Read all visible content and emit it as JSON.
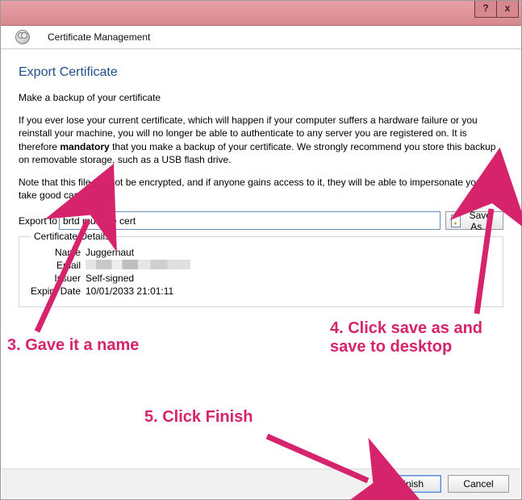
{
  "titlebar": {
    "help_symbol": "?",
    "close_symbol": "x"
  },
  "subheader": {
    "title": "Certificate Management"
  },
  "page": {
    "title": "Export Certificate",
    "intro": "Make a backup of your certificate",
    "para1_a": "If you ever lose your current certificate, which will happen if your computer suffers a hardware failure or you reinstall your machine, you will no longer be able to authenticate to any server you are registered on. It is therefore ",
    "para1_strong": "mandatory",
    "para1_b": " that you make a backup of your certificate. We strongly recommend you store this backup on removable storage, such as a USB flash drive.",
    "para2": "Note that this file will not be encrypted, and if anyone gains access to it, they will be able to impersonate you, so take good care of it."
  },
  "export": {
    "label": "Export to",
    "value": "brtd mumble cert",
    "save_label": "Save As..."
  },
  "details": {
    "legend": "Certificate Details",
    "name_label": "Name",
    "name_value": "Juggernaut",
    "email_label": "Email",
    "issuer_label": "Issuer",
    "issuer_value": "Self-signed",
    "expiry_label": "Expiry Date",
    "expiry_value": "10/01/2033 21:01:11"
  },
  "buttons": {
    "finish": "Finish",
    "cancel": "Cancel"
  },
  "annotations": {
    "a3": "3. Gave it a name",
    "a4a": "4. Click save as and",
    "a4b": "save to desktop",
    "a5": "5. Click Finish"
  }
}
